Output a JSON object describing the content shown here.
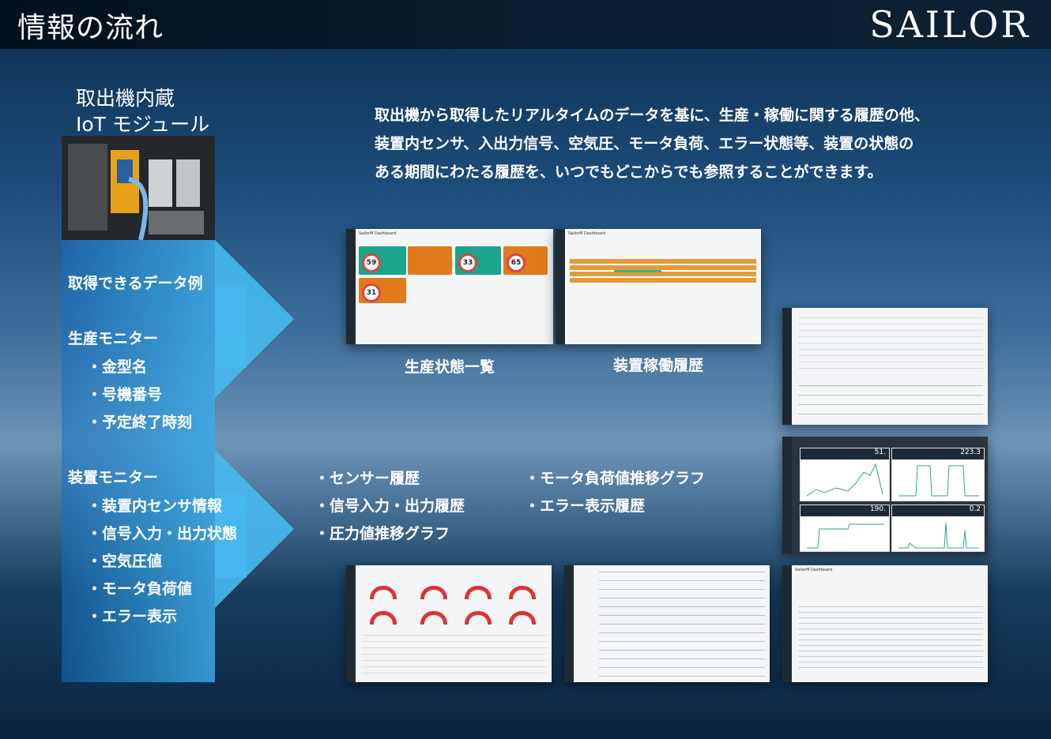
{
  "header": {
    "title": "情報の流れ",
    "logo": "SAILOR"
  },
  "module": {
    "line1": "取出機内蔵",
    "line2": "IoT モジュール"
  },
  "sections": {
    "examples": "取得できるデータ例",
    "production": "生産モニター",
    "production_items": [
      "・金型名",
      "・号機番号",
      "・予定終了時刻"
    ],
    "device": "装置モニター",
    "device_items": [
      "・装置内センサ情報",
      "・信号入力・出力状態",
      "・空気圧値",
      "・モータ負荷値",
      "・エラー表示"
    ]
  },
  "description": [
    "取出機から取得したリアルタイムのデータを基に、生産・稼働に関する履歴の他、",
    "装置内センサ、入出力信号、空気圧、モータ負荷、エラー状態等、装置の状態の",
    "ある期間にわたる履歴を、いつでもどこからでも参照することができます。"
  ],
  "history": {
    "col1": [
      "・センサー履歴",
      "・信号入力・出力履歴",
      "・圧力値推移グラフ"
    ],
    "col2": [
      "・モータ負荷値推移グラフ",
      "・エラー表示履歴"
    ]
  },
  "captions": {
    "production_status": "生産状態一覧",
    "device_history": "装置稼働履歴"
  },
  "screens": {
    "dashboard_title": "SailorM Dashboard",
    "percents": [
      "59",
      "33",
      "65",
      "31"
    ],
    "chart_values": [
      "51.",
      "223.3",
      "190.",
      "0.2"
    ],
    "gauge_values": [
      "0",
      "0",
      "0",
      "0",
      "0",
      "0.2",
      "0",
      "0"
    ]
  },
  "colors": {
    "teal": "#1aa58f",
    "orange": "#e07b1c",
    "accent": "#46b9f0"
  }
}
